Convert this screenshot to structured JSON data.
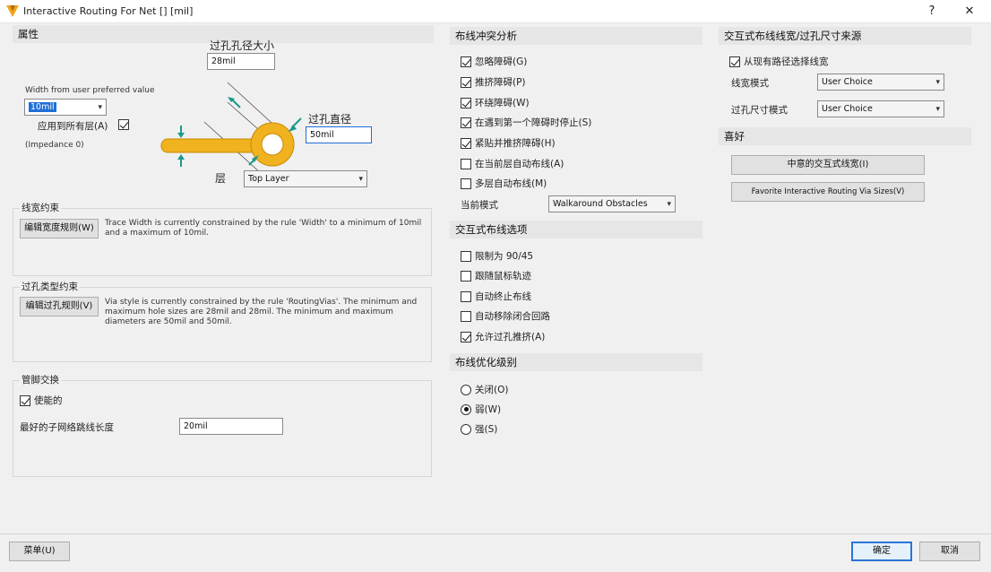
{
  "window": {
    "title": "Interactive Routing For Net [] [mil]",
    "help_glyph": "?",
    "close_glyph": "✕"
  },
  "properties": {
    "header": "属性",
    "via_hole_size_label": "过孔孔径大小",
    "via_hole_size_value": "28mil",
    "width_from_label": "Width from user preferred value",
    "width_value": "10mil",
    "apply_all_layers_label": "应用到所有层(A)",
    "impedance_label": "(Impedance 0)",
    "via_diameter_label": "过孔直径",
    "via_diameter_value": "50mil",
    "layer_label": "层",
    "layer_value": "Top Layer"
  },
  "width_constraint": {
    "header": "线宽约束",
    "button": "编辑宽度规则(W)",
    "description": "Trace Width is currently constrained by the rule 'Width' to a minimum of 10mil and a maximum of 10mil."
  },
  "via_constraint": {
    "header": "过孔类型约束",
    "button": "编辑过孔规则(V)",
    "description": "Via style is currently constrained by the rule 'RoutingVias'. The minimum and maximum hole sizes are 28mil and 28mil. The minimum and maximum diameters are 50mil and 50mil."
  },
  "pin_swap": {
    "header": "管脚交换",
    "enabled_label": "使能的",
    "subnet_jumper_label": "最好的子网络跳线长度",
    "subnet_jumper_value": "20mil"
  },
  "conflict": {
    "header": "布线冲突分析",
    "items": [
      {
        "label": "忽略障碍(G)",
        "checked": true
      },
      {
        "label": "推挤障碍(P)",
        "checked": true
      },
      {
        "label": "环绕障碍(W)",
        "checked": true
      },
      {
        "label": "在遇到第一个障碍时停止(S)",
        "checked": true
      },
      {
        "label": "紧贴并推挤障碍(H)",
        "checked": true
      },
      {
        "label": "在当前层自动布线(A)",
        "checked": false
      },
      {
        "label": "多层自动布线(M)",
        "checked": false
      }
    ],
    "current_mode_label": "当前模式",
    "current_mode_value": "Walkaround Obstacles"
  },
  "interactive_options": {
    "header": "交互式布线选项",
    "items": [
      {
        "label": "限制为 90/45",
        "checked": false
      },
      {
        "label": "跟随鼠标轨迹",
        "checked": false
      },
      {
        "label": "自动终止布线",
        "checked": false
      },
      {
        "label": "自动移除闭合回路",
        "checked": false
      },
      {
        "label": "允许过孔推挤(A)",
        "checked": true
      }
    ]
  },
  "optimization": {
    "header": "布线优化级别",
    "items": [
      {
        "label": "关闭(O)",
        "selected": false
      },
      {
        "label": "弱(W)",
        "selected": true
      },
      {
        "label": "强(S)",
        "selected": false
      }
    ]
  },
  "width_via_source": {
    "header": "交互式布线线宽/过孔尺寸来源",
    "pickup_label": "从现有路径选择线宽",
    "width_mode_label": "线宽模式",
    "width_mode_value": "User Choice",
    "via_size_mode_label": "过孔尺寸模式",
    "via_size_mode_value": "User Choice"
  },
  "favorites": {
    "header": "喜好",
    "fav_width_button": "中意的交互式线宽(I)",
    "fav_via_button": "Favorite Interactive Routing Via Sizes(V)"
  },
  "footer": {
    "menu_button": "菜单(U)",
    "ok_button": "确定",
    "cancel_button": "取消"
  },
  "colors": {
    "accent": "#2a74d6",
    "track": "#f0b21e",
    "dimension": "#1a9a8a"
  }
}
